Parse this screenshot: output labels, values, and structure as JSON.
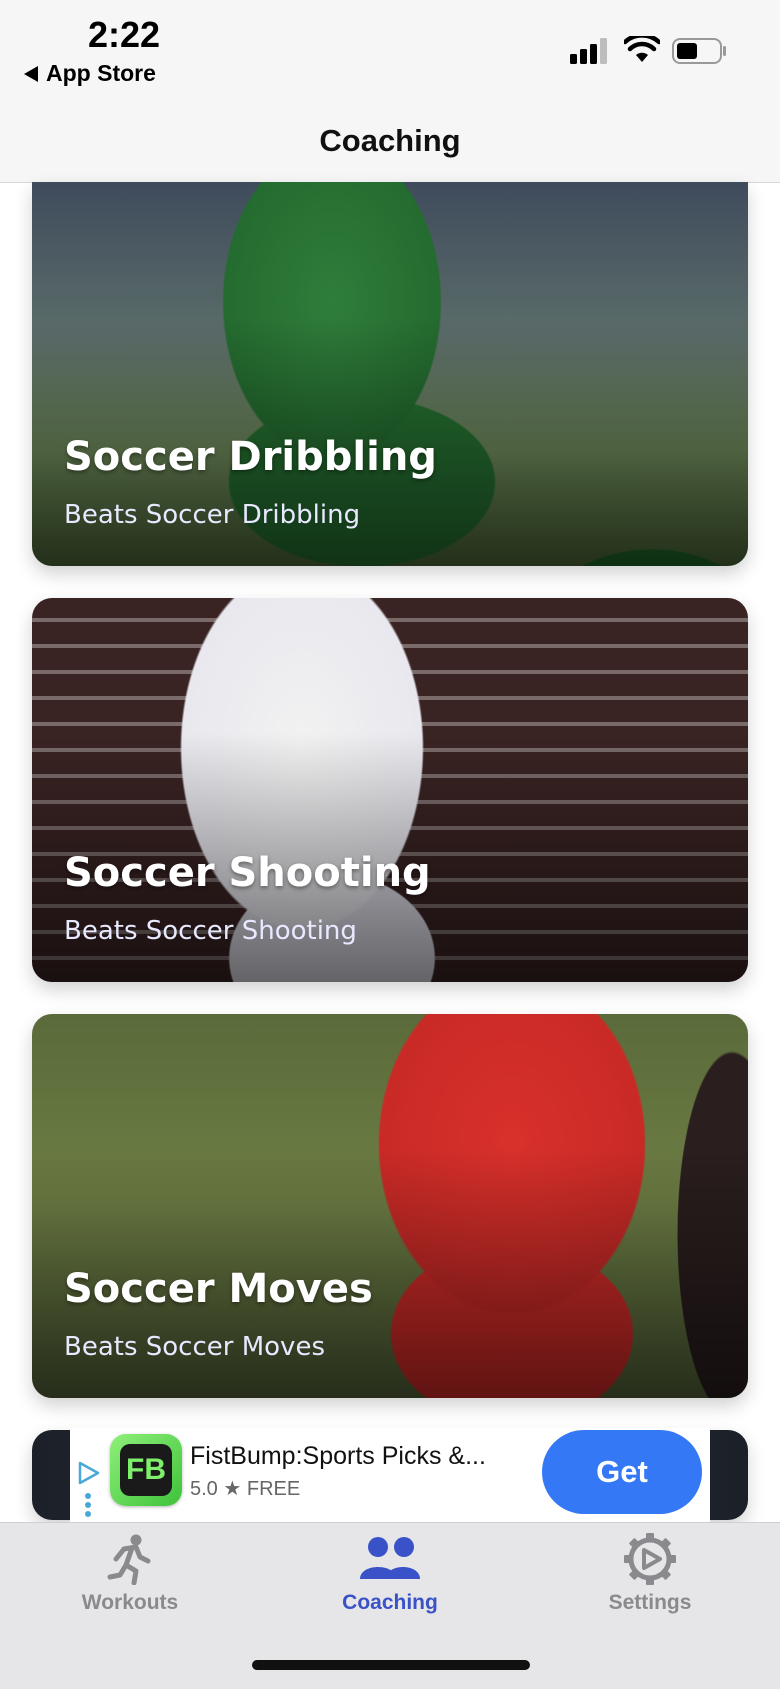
{
  "status_bar": {
    "time": "2:22",
    "back_label": "App Store"
  },
  "nav": {
    "title": "Coaching"
  },
  "cards": [
    {
      "title": "Soccer Dribbling",
      "subtitle": "Beats Soccer Dribbling"
    },
    {
      "title": "Soccer Shooting",
      "subtitle": "Beats Soccer Shooting"
    },
    {
      "title": "Soccer Moves",
      "subtitle": "Beats Soccer Moves"
    }
  ],
  "ad": {
    "app_icon_text": "FB",
    "app_name": "FistBump:Sports Picks &...",
    "rating": "5.0 ★ FREE",
    "button_label": "Get"
  },
  "tab_bar": {
    "tabs": [
      {
        "label": "Workouts",
        "icon": "running-person-icon",
        "color": "#8a8a8e"
      },
      {
        "label": "Coaching",
        "icon": "people-icon",
        "color": "#3a52c8"
      },
      {
        "label": "Settings",
        "icon": "gear-play-icon",
        "color": "#8a8a8e"
      }
    ],
    "selected": "Coaching"
  },
  "colors": {
    "accent": "#3a52c8",
    "get_button": "#3478f6",
    "inactive_tab": "#8a8a8e"
  }
}
